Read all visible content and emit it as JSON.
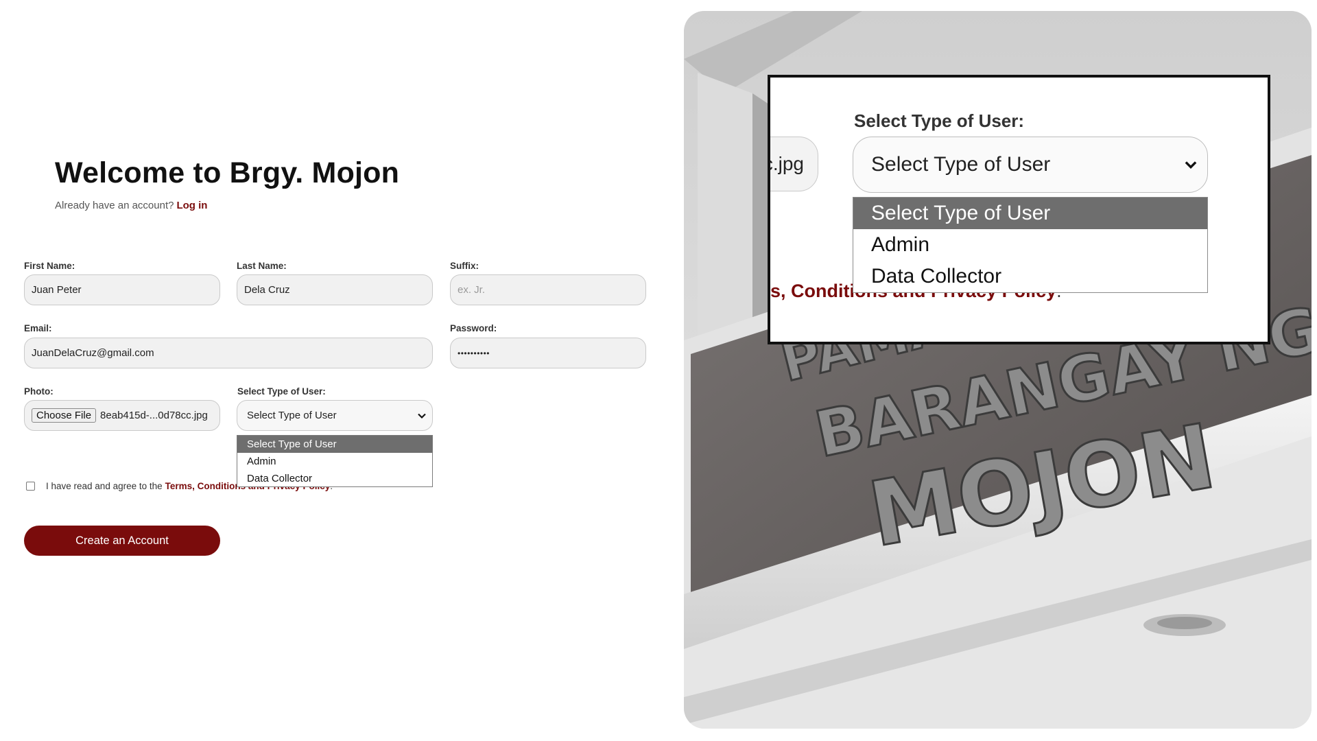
{
  "header": {
    "title": "Welcome to Brgy. Mojon",
    "login_prompt": "Already have an account?",
    "login_link": "Log in"
  },
  "form": {
    "first_name": {
      "label": "First Name:",
      "value": "Juan Peter"
    },
    "last_name": {
      "label": "Last Name:",
      "value": "Dela Cruz"
    },
    "suffix": {
      "label": "Suffix:",
      "placeholder": "ex. Jr."
    },
    "email": {
      "label": "Email:",
      "value": "JuanDelaCruz@gmail.com"
    },
    "password": {
      "label": "Password:",
      "value": "••••••••••"
    },
    "photo": {
      "label": "Photo:",
      "button": "Choose File",
      "file_name": "8eab415d-...0d78cc.jpg"
    },
    "user_type": {
      "label": "Select Type of User:",
      "selected": "Select Type of User",
      "options": [
        "Select Type of User",
        "Admin",
        "Data Collector"
      ]
    },
    "agreement": {
      "text": "I have read and agree to the",
      "link": "Terms, Conditions and Privacy Policy",
      "suffix": "."
    },
    "submit_label": "Create an Account"
  },
  "photo_panel": {
    "signage": [
      "PAMAHALAANG",
      "BARANGAY NG",
      "MOJON"
    ]
  },
  "zoom": {
    "file_fragment": "c.jpg",
    "label": "Select Type of User:",
    "selected": "Select Type of User",
    "options": [
      "Select Type of User",
      "Admin",
      "Data Collector"
    ],
    "terms_fragment": "s, Conditions and Privacy Policy",
    "terms_suffix": "."
  },
  "colors": {
    "accent": "#7a0c0c",
    "dropdown_selected_bg": "#6e6e6e",
    "field_bg": "#f1f1f1"
  },
  "icons": {
    "select_arrow": "chevron-down-icon"
  }
}
